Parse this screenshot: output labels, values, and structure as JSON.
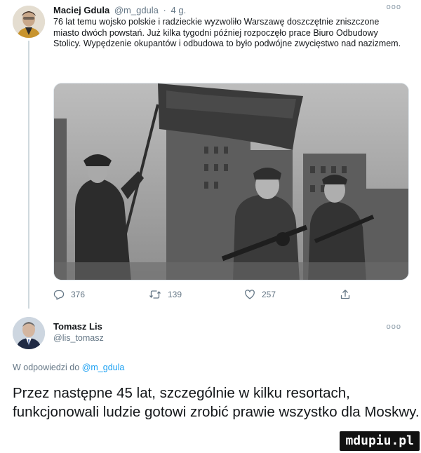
{
  "tweet": {
    "author_name": "Maciej Gdula",
    "author_handle": "@m_gdula",
    "separator": "·",
    "time": "4 g.",
    "more_label": "ooo",
    "text": "76 lat temu wojsko polskie i radzieckie wyzwoliło Warszawę doszczętnie zniszczone miasto dwóch powstań. Już kilka tygodni później rozpoczęło prace Biuro Odbudowy Stolicy. Wypędzenie okupantów i odbudowa to było podwójne zwycięstwo nad nazizmem.",
    "actions": {
      "reply_count": "376",
      "retweet_count": "139",
      "like_count": "257"
    },
    "icons": [
      "reply-icon",
      "retweet-icon",
      "like-icon",
      "share-icon"
    ]
  },
  "reply": {
    "author_name": "Tomasz Lis",
    "author_handle": "@lis_tomasz",
    "more_label": "ooo",
    "reply_prefix": "W odpowiedzi do",
    "reply_to_handle": "@m_gdula",
    "text": "Przez następne 45 lat, szczególnie w kilku resortach, funkcjonowali ludzie gotowi zrobić prawie wszystko dla Moskwy."
  },
  "watermark": "mdupiu.pl",
  "colors": {
    "text": "#14171a",
    "secondary": "#657786",
    "link": "#1da1f2",
    "divider": "#cfd9de"
  }
}
